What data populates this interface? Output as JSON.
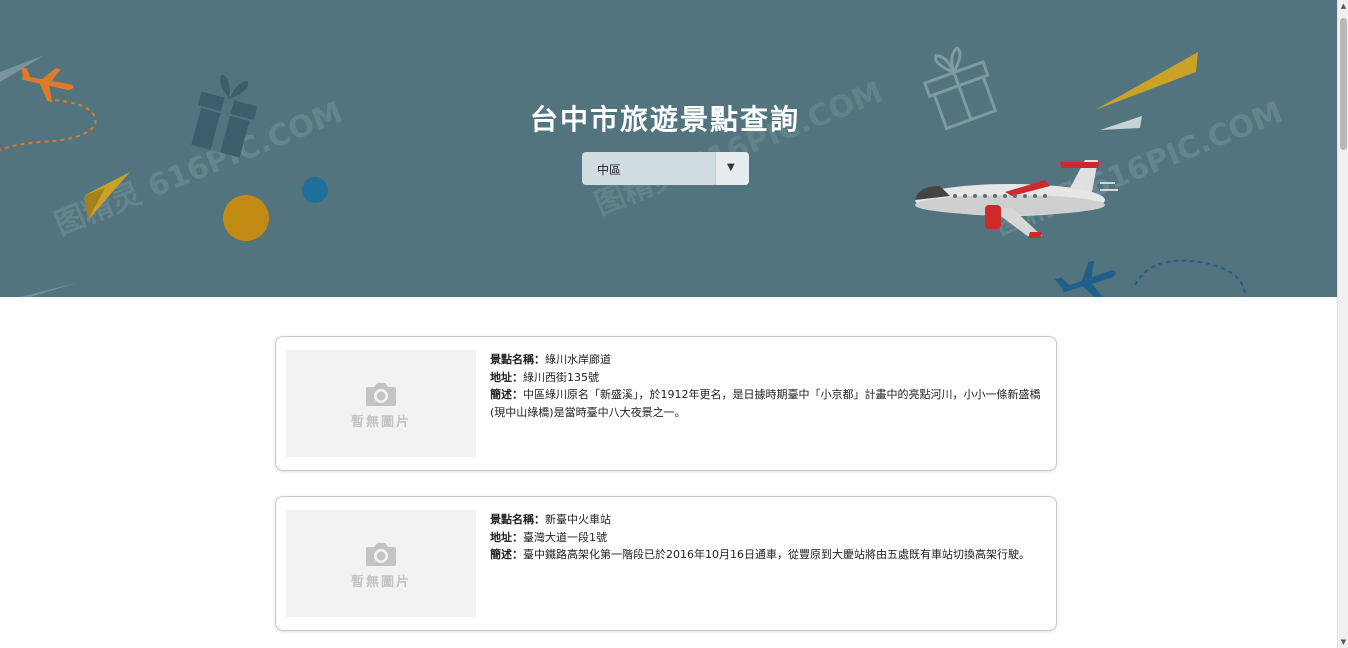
{
  "header": {
    "title": "台中市旅遊景點查詢",
    "district_select": {
      "value": "中區",
      "arrow": "▼"
    }
  },
  "banner": {
    "watermark": "图精灵 616PIC.COM",
    "colors": {
      "background": "#51747e",
      "accent_orange": "#e07a2b",
      "accent_gold": "#c9a227",
      "accent_blue": "#1f6f9a"
    }
  },
  "attractions": [
    {
      "thumb_icon": "camera-icon",
      "thumb_label": "暫無圖片",
      "name_label": "景點名稱：",
      "name": "綠川水岸廊道",
      "address_label": "地址：",
      "address": "綠川西街135號",
      "desc_label": "簡述：",
      "description": "中區綠川原名「新盛溪」，於1912年更名，是日據時期臺中「小京都」計畫中的亮點河川，小小一條新盛橋(現中山綠橋)是當時臺中八大夜景之一。"
    },
    {
      "thumb_icon": "camera-icon",
      "thumb_label": "暫無圖片",
      "name_label": "景點名稱：",
      "name": "新臺中火車站",
      "address_label": "地址：",
      "address": "臺灣大道一段1號",
      "desc_label": "簡述：",
      "description": "臺中鐵路高架化第一階段已於2016年10月16日通車，從豐原到大慶站將由五處既有車站切換高架行駛。"
    }
  ],
  "scrollbar": {
    "up_arrow": "▲",
    "down_arrow": "▼"
  }
}
